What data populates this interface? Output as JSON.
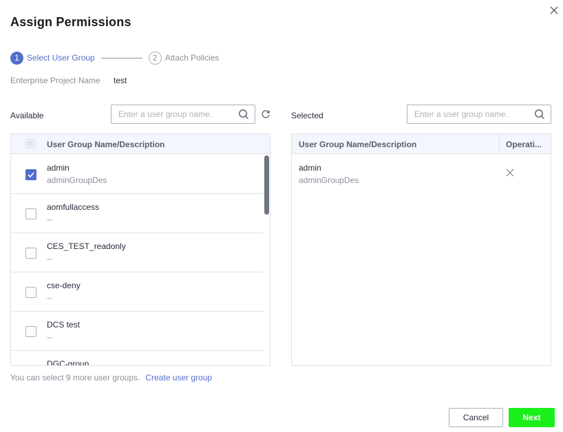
{
  "dialog": {
    "title": "Assign Permissions"
  },
  "steps": [
    {
      "number": "1",
      "label": "Select User Group",
      "state": "active"
    },
    {
      "number": "2",
      "label": "Attach Policies",
      "state": "inactive"
    }
  ],
  "enterprise_project": {
    "label": "Enterprise Project Name",
    "value": "test"
  },
  "available": {
    "label": "Available",
    "search_placeholder": "Enter a user group name.",
    "header": "User Group Name/Description",
    "rows": [
      {
        "name": "admin",
        "description": "adminGroupDes",
        "checked": true
      },
      {
        "name": "aomfullaccess",
        "description": "--",
        "checked": false
      },
      {
        "name": "CES_TEST_readonly",
        "description": "--",
        "checked": false
      },
      {
        "name": "cse-deny",
        "description": "--",
        "checked": false
      },
      {
        "name": "DCS test",
        "description": "--",
        "checked": false
      },
      {
        "name": "DGC-group",
        "description": "",
        "checked": false
      }
    ]
  },
  "selected": {
    "label": "Selected",
    "search_placeholder": "Enter a user group name.",
    "header_name": "User Group Name/Description",
    "header_operation": "Operati...",
    "rows": [
      {
        "name": "admin",
        "description": "adminGroupDes"
      }
    ]
  },
  "footer": {
    "hint": "You can select 9 more user groups.",
    "link": "Create user group"
  },
  "buttons": {
    "cancel": "Cancel",
    "next": "Next"
  },
  "colors": {
    "accent": "#526ecc",
    "next_button": "#1bef1b",
    "header_bg": "#f3f6fd"
  }
}
